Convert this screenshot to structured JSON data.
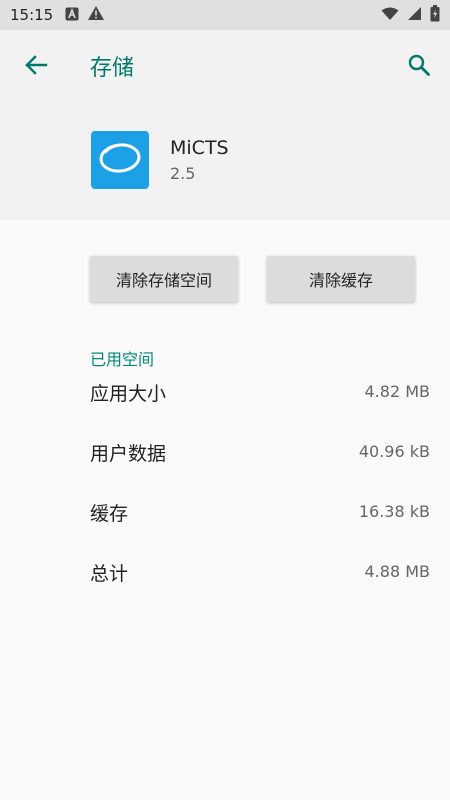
{
  "status_bar": {
    "time": "15:15",
    "left_icons": [
      "font-icon",
      "warning-icon"
    ],
    "right_icons": [
      "wifi-icon",
      "signal-icon",
      "battery-icon"
    ]
  },
  "header": {
    "title": "存储",
    "back_icon": "arrow-left-icon",
    "search_icon": "search-icon",
    "accent_color": "#00796b"
  },
  "app": {
    "name": "MiCTS",
    "version": "2.5",
    "icon_color": "#1da1e6"
  },
  "buttons": {
    "clear_storage": "清除存储空间",
    "clear_cache": "清除缓存"
  },
  "section": {
    "title": "已用空间"
  },
  "storage": [
    {
      "label": "应用大小",
      "value": "4.82 MB"
    },
    {
      "label": "用户数据",
      "value": "40.96 kB"
    },
    {
      "label": "缓存",
      "value": "16.38 kB"
    },
    {
      "label": "总计",
      "value": "4.88 MB"
    }
  ]
}
